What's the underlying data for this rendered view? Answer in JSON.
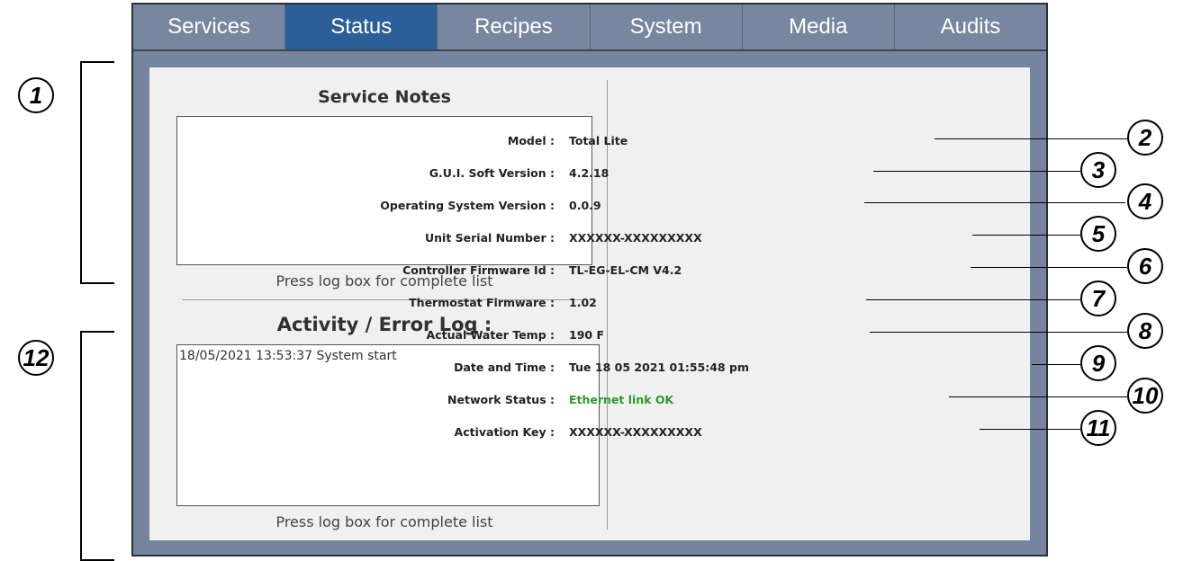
{
  "tabs": [
    "Services",
    "Status",
    "Recipes",
    "System",
    "Media",
    "Audits"
  ],
  "active_tab": "Status",
  "service_notes": {
    "title": "Service Notes",
    "hint": "Press log box for complete list"
  },
  "activity_log": {
    "title": "Activity / Error Log :",
    "entries": [
      "18/05/2021 13:53:37 System start"
    ],
    "hint": "Press log box for complete list"
  },
  "info": [
    {
      "label": "Model :",
      "value": "Total Lite"
    },
    {
      "label": "G.U.I. Soft Version :",
      "value": "4.2.18"
    },
    {
      "label": "Operating System Version :",
      "value": "0.0.9"
    },
    {
      "label": "Unit Serial Number :",
      "value": "XXXXXX-XXXXXXXXX"
    },
    {
      "label": "Controller Firmware Id :",
      "value": "TL-EG-EL-CM V4.2"
    },
    {
      "label": "Thermostat Firmware :",
      "value": "1.02"
    },
    {
      "label": "Actual Water Temp :",
      "value": "190 F"
    },
    {
      "label": "Date and Time :",
      "value": "Tue 18 05 2021 01:55:48 pm"
    },
    {
      "label": "Network Status :",
      "value": "Ethernet link OK",
      "status_color": "#2a9a2a"
    },
    {
      "label": "Activation Key :",
      "value": "XXXXXX-XXXXXXXXX"
    }
  ],
  "callouts": [
    "1",
    "2",
    "3",
    "4",
    "5",
    "6",
    "7",
    "8",
    "9",
    "10",
    "11",
    "12"
  ]
}
